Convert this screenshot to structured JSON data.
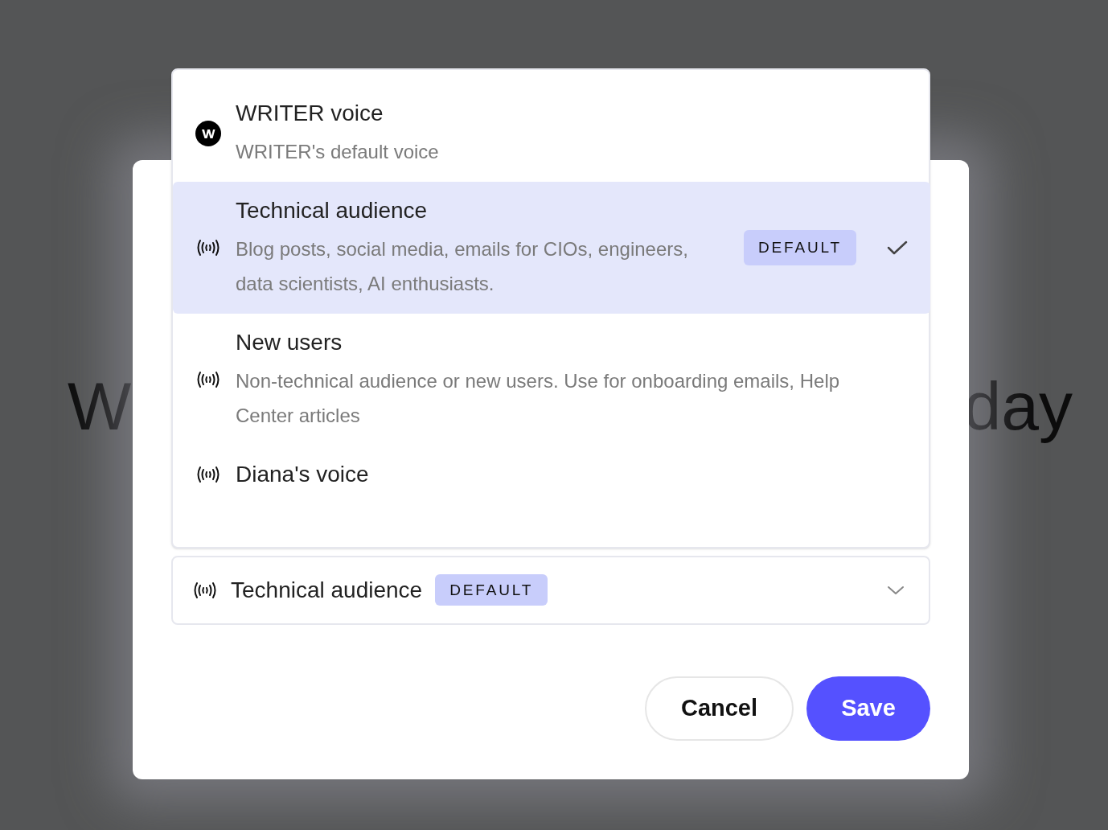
{
  "background_heading": {
    "left": "W",
    "right": "day"
  },
  "voice_menu": {
    "options": [
      {
        "kind": "logo",
        "title": "WRITER voice",
        "description": "WRITER's default voice",
        "selected": false
      },
      {
        "kind": "signal",
        "title": "Technical audience",
        "description": "Blog posts, social media, emails for CIOs, engineers, data scientists, AI enthusiasts.",
        "badge": "DEFAULT",
        "selected": true
      },
      {
        "kind": "signal",
        "title": "New users",
        "description": "Non-technical audience or new users. Use for onboarding emails, Help Center articles",
        "selected": false
      },
      {
        "kind": "signal",
        "title": "Diana's voice",
        "selected": false
      }
    ]
  },
  "voice_select": {
    "value": "Technical audience",
    "badge": "DEFAULT",
    "expanded": true
  },
  "buttons": [
    {
      "kind": "secondary",
      "label": "Cancel"
    },
    {
      "kind": "primary",
      "label": "Save"
    }
  ]
}
